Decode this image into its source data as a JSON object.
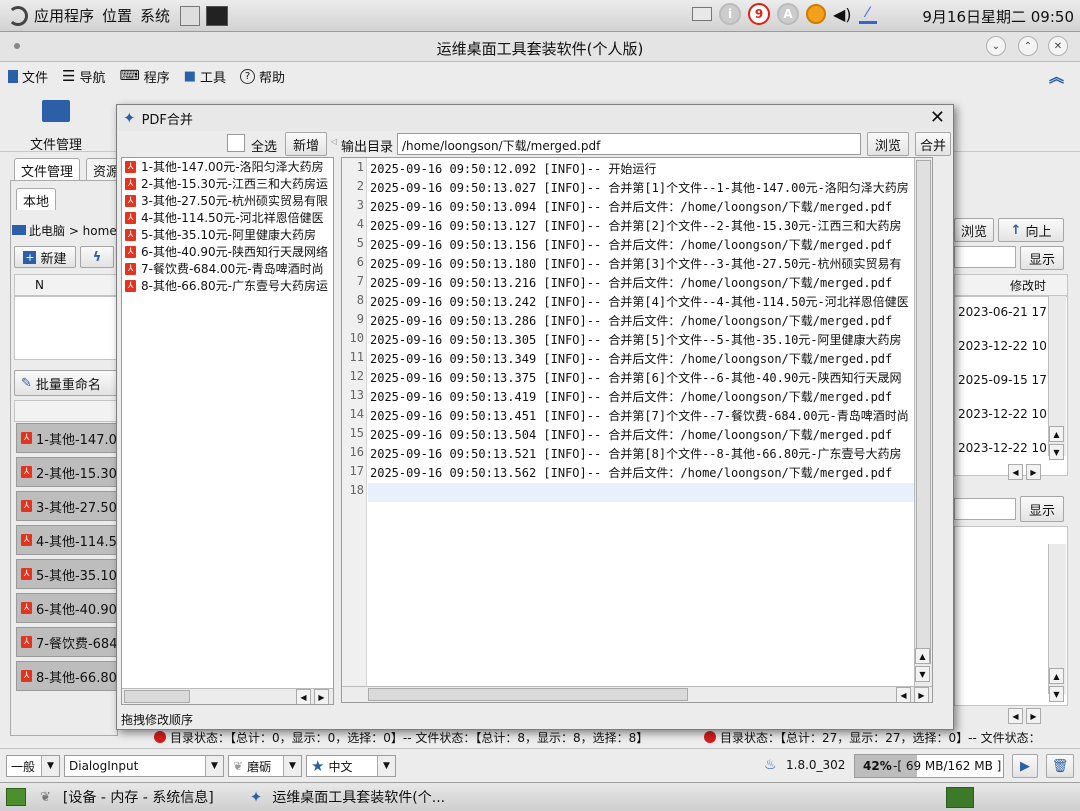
{
  "system_bar": {
    "menus": [
      "应用程序",
      "位置",
      "系统"
    ],
    "tray_badge": "9",
    "clock": "9月16日星期二 09:50"
  },
  "app": {
    "title": "运维桌面工具套装软件(个人版)",
    "menu": [
      "文件",
      "导航",
      "程序",
      "工具",
      "帮助"
    ],
    "toolbar_label": "文件管理",
    "tabs": [
      "文件管理",
      "资源"
    ],
    "sub_tab": "本地",
    "path": "此电脑 > home",
    "new_button": "新建",
    "col_n": "N",
    "rename_button": "批量重命名",
    "left_rows": [
      "1-其他-147.0",
      "2-其他-15.30",
      "3-其他-27.50",
      "4-其他-114.5",
      "5-其他-35.10",
      "6-其他-40.90",
      "7-餐饮费-684",
      "8-其他-66.80"
    ],
    "right": {
      "browse": "浏览",
      "up": "向上",
      "show": "显示",
      "modified_col": "修改时",
      "dates": [
        "2023-06-21 17",
        "2023-12-22 10:",
        "2025-09-15 17:",
        "2023-12-22 10:",
        "2023-12-22 10:"
      ],
      "show2": "显示"
    },
    "status_text_left": "目录状态：【总计：0，显示：0，选择：0】-- 文件状态：【总计：8，显示：8，选择：8】",
    "status_text_right": "目录状态：【总计：27，显示：27，选择：0】-- 文件状态："
  },
  "status_bar": {
    "mode": "一般",
    "font": "DialogInput",
    "theme": "磨砺",
    "lang": "中文",
    "java": "1.8.0_302",
    "mem_percent": "42%",
    "mem_text": "-[ 69 MB/162 MB ]",
    "mem_fraction": 0.42
  },
  "taskbar": {
    "items": [
      "[设备 - 内存 - 系统信息]",
      "运维桌面工具套装软件(个..."
    ]
  },
  "dialog": {
    "title": "PDF合并",
    "select_all": "全选",
    "add_button": "新增",
    "output_label": "输出目录",
    "output_path": "/home/loongson/下载/merged.pdf",
    "browse_button": "浏览",
    "merge_button": "合并",
    "hint": "拖拽修改顺序",
    "files": [
      "1-其他-147.00元-洛阳匀泽大药房",
      "2-其他-15.30元-江西三和大药房运",
      "3-其他-27.50元-杭州硕实贸易有限",
      "4-其他-114.50元-河北祥恩倍健医",
      "5-其他-35.10元-阿里健康大药房",
      "6-其他-40.90元-陕西知行天晟网络",
      "7-餐饮费-684.00元-青岛啤酒时尚",
      "8-其他-66.80元-广东壹号大药房运"
    ],
    "log": [
      "2025-09-16 09:50:12.092 [INFO]-- 开始运行",
      "2025-09-16 09:50:13.027 [INFO]-- 合并第[1]个文件--1-其他-147.00元-洛阳匀泽大药房",
      "2025-09-16 09:50:13.094 [INFO]-- 合并后文件：/home/loongson/下载/merged.pdf",
      "2025-09-16 09:50:13.127 [INFO]-- 合并第[2]个文件--2-其他-15.30元-江西三和大药房",
      "2025-09-16 09:50:13.156 [INFO]-- 合并后文件：/home/loongson/下载/merged.pdf",
      "2025-09-16 09:50:13.180 [INFO]-- 合并第[3]个文件--3-其他-27.50元-杭州硕实贸易有",
      "2025-09-16 09:50:13.216 [INFO]-- 合并后文件：/home/loongson/下载/merged.pdf",
      "2025-09-16 09:50:13.242 [INFO]-- 合并第[4]个文件--4-其他-114.50元-河北祥恩倍健医",
      "2025-09-16 09:50:13.286 [INFO]-- 合并后文件：/home/loongson/下载/merged.pdf",
      "2025-09-16 09:50:13.305 [INFO]-- 合并第[5]个文件--5-其他-35.10元-阿里健康大药房",
      "2025-09-16 09:50:13.349 [INFO]-- 合并后文件：/home/loongson/下载/merged.pdf",
      "2025-09-16 09:50:13.375 [INFO]-- 合并第[6]个文件--6-其他-40.90元-陕西知行天晟网",
      "2025-09-16 09:50:13.419 [INFO]-- 合并后文件：/home/loongson/下载/merged.pdf",
      "2025-09-16 09:50:13.451 [INFO]-- 合并第[7]个文件--7-餐饮费-684.00元-青岛啤酒时尚",
      "2025-09-16 09:50:13.504 [INFO]-- 合并后文件：/home/loongson/下载/merged.pdf",
      "2025-09-16 09:50:13.521 [INFO]-- 合并第[8]个文件--8-其他-66.80元-广东壹号大药房",
      "2025-09-16 09:50:13.562 [INFO]-- 合并后文件：/home/loongson/下载/merged.pdf",
      ""
    ]
  }
}
